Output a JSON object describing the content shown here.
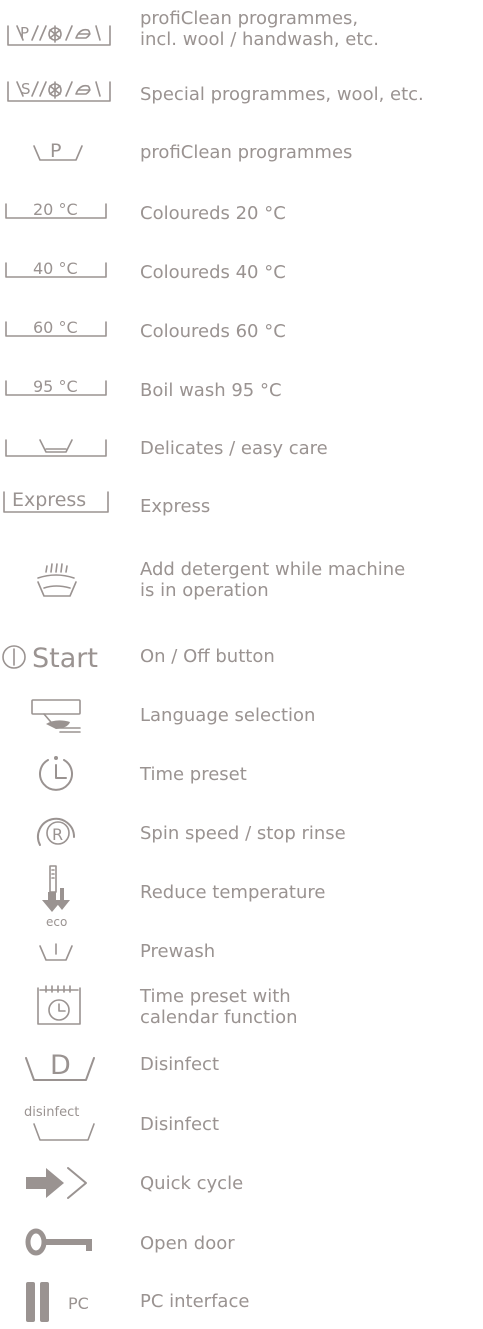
{
  "items": [
    {
      "icon": "profiClean-wool-handwash-basin-icon",
      "lines": [
        "profiClean programmes,",
        "incl. wool / handwash, etc."
      ]
    },
    {
      "icon": "special-wool-handwash-basin-icon",
      "lines": [
        "Special programmes, wool, etc."
      ]
    },
    {
      "icon": "profiClean-basin-icon",
      "lines": [
        "profiClean programmes"
      ]
    },
    {
      "icon": "basin-20c-icon",
      "symbol": "20 °C",
      "lines": [
        "Coloureds 20 °C"
      ]
    },
    {
      "icon": "basin-40c-icon",
      "symbol": "40 °C",
      "lines": [
        "Coloureds 40 °C"
      ]
    },
    {
      "icon": "basin-60c-icon",
      "symbol": "60 °C",
      "lines": [
        "Coloureds 60 °C"
      ]
    },
    {
      "icon": "basin-95c-icon",
      "symbol": "95 °C",
      "lines": [
        "Boil wash 95 °C"
      ]
    },
    {
      "icon": "delicates-basin-icon",
      "lines": [
        "Delicates / easy care"
      ]
    },
    {
      "icon": "express-basin-icon",
      "symbol": "Express",
      "lines": [
        "Express"
      ]
    },
    {
      "icon": "add-detergent-icon",
      "lines": [
        "Add detergent while machine",
        "is in operation"
      ]
    },
    {
      "icon": "power-start-icon",
      "symbol": "Start",
      "lines": [
        "On / Off button"
      ]
    },
    {
      "icon": "language-selection-icon",
      "lines": [
        "Language selection"
      ]
    },
    {
      "icon": "time-preset-icon",
      "lines": [
        "Time preset"
      ]
    },
    {
      "icon": "spin-speed-icon",
      "symbol": "R",
      "lines": [
        "Spin speed / stop rinse"
      ]
    },
    {
      "icon": "reduce-temperature-icon",
      "symbol": "eco",
      "lines": [
        "Reduce temperature"
      ]
    },
    {
      "icon": "prewash-icon",
      "lines": [
        "Prewash"
      ]
    },
    {
      "icon": "calendar-timer-icon",
      "lines": [
        "Time preset with",
        "calendar function"
      ]
    },
    {
      "icon": "disinfect-basin-icon",
      "symbol": "D",
      "lines": [
        "Disinfect"
      ]
    },
    {
      "icon": "disinfect-text-basin-icon",
      "symbol": "disinfect",
      "lines": [
        "Disinfect"
      ]
    },
    {
      "icon": "quick-cycle-icon",
      "lines": [
        "Quick cycle"
      ]
    },
    {
      "icon": "open-door-key-icon",
      "lines": [
        "Open door"
      ]
    },
    {
      "icon": "pc-interface-icon",
      "symbol": "PC",
      "lines": [
        "PC interface"
      ]
    }
  ],
  "colors": {
    "text": "#9a9391",
    "background": "#ffffff"
  }
}
